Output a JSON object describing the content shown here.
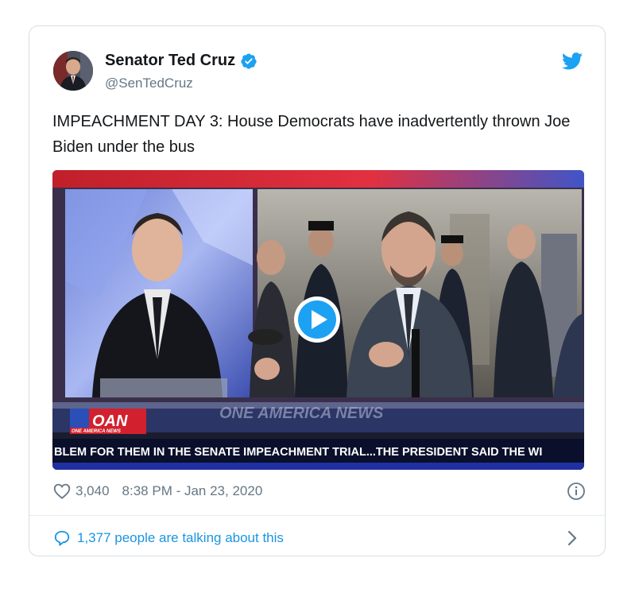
{
  "author": {
    "name": "Senator Ted Cruz",
    "handle": "@SenTedCruz",
    "verified": true
  },
  "tweet": {
    "text": "IMPEACHMENT DAY 3: House Democrats have inadvertently thrown Joe Biden under the bus"
  },
  "media": {
    "type": "video",
    "network_logo": "OAN",
    "network_sub": "ONE AMERICA NEWS",
    "watermark": "ONE AMERICA NEWS",
    "ticker": "BLEM FOR THEM IN THE SENATE IMPEACHMENT TRIAL...THE PRESIDENT SAID THE WI",
    "play_icon": "play-button-icon"
  },
  "footer": {
    "likes": "3,040",
    "time": "8:38 PM - Jan 23, 2020",
    "talking": "1,377 people are talking about this"
  },
  "colors": {
    "accent": "#1da1f2",
    "link": "#1b95e0",
    "muted": "#657786",
    "ticker_bg": "#0a0f2b",
    "oan_red": "#d2202f"
  },
  "icons": [
    "verified-badge-icon",
    "twitter-bird-icon",
    "heart-icon",
    "info-icon",
    "speech-bubble-icon",
    "chevron-right-icon"
  ]
}
